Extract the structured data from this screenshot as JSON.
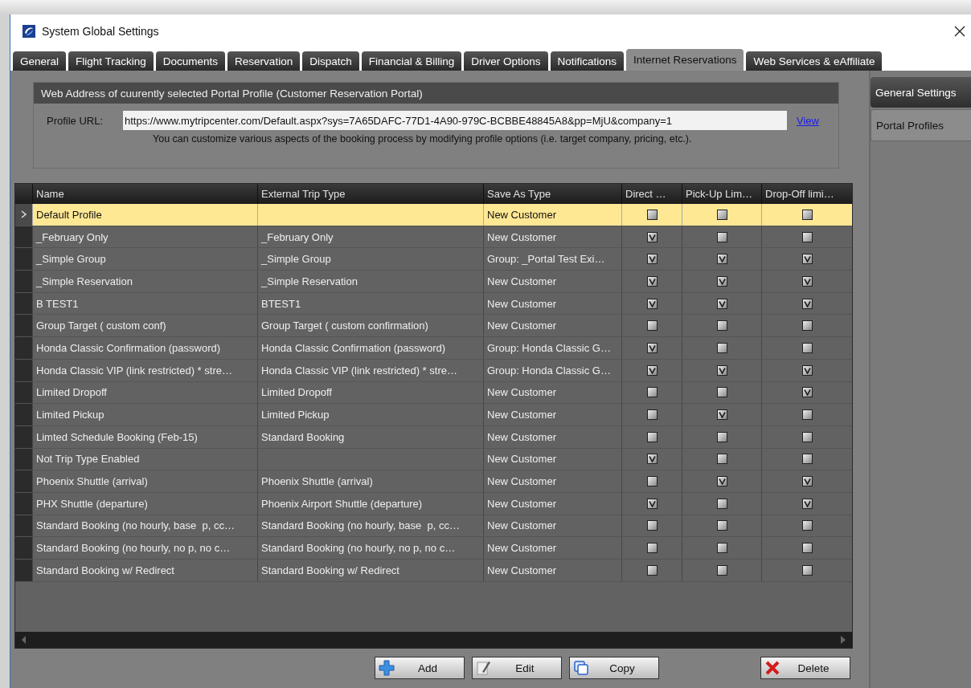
{
  "window": {
    "title": "System Global Settings"
  },
  "tabs": [
    {
      "label": "General",
      "selected": false
    },
    {
      "label": "Flight Tracking",
      "selected": false
    },
    {
      "label": "Documents",
      "selected": false
    },
    {
      "label": "Reservation",
      "selected": false
    },
    {
      "label": "Dispatch",
      "selected": false
    },
    {
      "label": "Financial & Billing",
      "selected": false
    },
    {
      "label": "Driver Options",
      "selected": false
    },
    {
      "label": "Notifications",
      "selected": false
    },
    {
      "label": "Internet Reservations",
      "selected": true
    },
    {
      "label": "Web Services & eAffiliate",
      "selected": false
    }
  ],
  "side_tabs": [
    {
      "label": "General Settings",
      "selected": false
    },
    {
      "label": "Portal Profiles",
      "selected": true
    }
  ],
  "portal_group": {
    "title": "Web Address of cuurently selected Portal Profile (Customer Reservation Portal)",
    "url_label": "Profile URL:",
    "url_value": "https://www.mytripcenter.com/Default.aspx?sys=7A65DAFC-77D1-4A90-979C-BCBBE48845A8&pp=MjU&company=1",
    "view_link": "View",
    "note": "You can customize various aspects of the booking process by modifying profile options (i.e. target company, pricing, etc.)."
  },
  "table": {
    "columns": [
      "Name",
      "External Trip Type",
      "Save As Type",
      "Direct …",
      "Pick-Up Lim…",
      "Drop-Off limi…"
    ],
    "rows": [
      {
        "name": "Default Profile",
        "save_as_type": "New Customer",
        "checks": [
          false,
          false,
          false
        ],
        "selected": true
      },
      {
        "name": "_February Only",
        "external_trip_type": "_February Only",
        "save_as_type": "New Customer",
        "checks": [
          true,
          false,
          false
        ],
        "selected": false
      },
      {
        "name": "_Simple Group",
        "external_trip_type": "_Simple Group",
        "save_as_type": "Group: _Portal Test Exi…",
        "checks": [
          true,
          true,
          true
        ],
        "selected": false
      },
      {
        "name": "_Simple Reservation",
        "external_trip_type": "_Simple Reservation",
        "save_as_type": "New Customer",
        "checks": [
          true,
          true,
          true
        ],
        "selected": false
      },
      {
        "name": "B TEST1",
        "external_trip_type": "BTEST1",
        "save_as_type": "New Customer",
        "checks": [
          true,
          true,
          true
        ],
        "selected": false
      },
      {
        "name": "Group Target ( custom conf)",
        "external_trip_type": "Group Target ( custom confirmation)",
        "save_as_type": "New Customer",
        "checks": [
          false,
          false,
          false
        ],
        "selected": false
      },
      {
        "name": "Honda Classic Confirmation (password)",
        "external_trip_type": "Honda Classic Confirmation (password)",
        "save_as_type": "Group: Honda Classic G…",
        "checks": [
          true,
          false,
          false
        ],
        "selected": false
      },
      {
        "name": "Honda Classic VIP (link restricted) * stre…",
        "external_trip_type": "Honda Classic VIP (link restricted) * stre…",
        "save_as_type": "Group: Honda Classic G…",
        "checks": [
          true,
          true,
          true
        ],
        "selected": false
      },
      {
        "name": "Limited Dropoff",
        "external_trip_type": "Limited Dropoff",
        "save_as_type": "New Customer",
        "checks": [
          false,
          false,
          true
        ],
        "selected": false
      },
      {
        "name": "Limited Pickup",
        "external_trip_type": "Limited Pickup",
        "save_as_type": "New Customer",
        "checks": [
          false,
          true,
          false
        ],
        "selected": false
      },
      {
        "name": "Limted Schedule Booking (Feb-15)",
        "external_trip_type": "Standard Booking",
        "save_as_type": "New Customer",
        "checks": [
          false,
          false,
          false
        ],
        "selected": false
      },
      {
        "name": "Not Trip Type Enabled",
        "save_as_type": "New Customer",
        "checks": [
          true,
          false,
          false
        ],
        "selected": false
      },
      {
        "name": "Phoenix Shuttle (arrival)",
        "external_trip_type": "Phoenix Shuttle (arrival)",
        "save_as_type": "New Customer",
        "checks": [
          false,
          true,
          true
        ],
        "selected": false
      },
      {
        "name": "PHX Shuttle (departure)",
        "external_trip_type": "Phoenix Airport Shuttle (departure)",
        "save_as_type": "New Customer",
        "checks": [
          true,
          false,
          true
        ],
        "selected": false
      },
      {
        "name": "Standard Booking (no hourly, base  p, cc…",
        "external_trip_type": "Standard Booking (no hourly, base  p, cc…",
        "save_as_type": "New Customer",
        "checks": [
          false,
          false,
          false
        ],
        "selected": false
      },
      {
        "name": "Standard Booking (no hourly, no p, no c…",
        "external_trip_type": "Standard Booking (no hourly, no p, no c…",
        "save_as_type": "New Customer",
        "checks": [
          false,
          false,
          false
        ],
        "selected": false
      },
      {
        "name": "Standard Booking w/ Redirect",
        "external_trip_type": "Standard Booking w/ Redirect",
        "save_as_type": "New Customer",
        "checks": [
          false,
          false,
          false
        ],
        "selected": false
      }
    ]
  },
  "buttons": [
    {
      "label": "Add",
      "kind": "add"
    },
    {
      "label": "Edit",
      "kind": "edit"
    },
    {
      "label": "Copy",
      "kind": "copy"
    },
    {
      "label": "Delete",
      "kind": "delete"
    }
  ]
}
